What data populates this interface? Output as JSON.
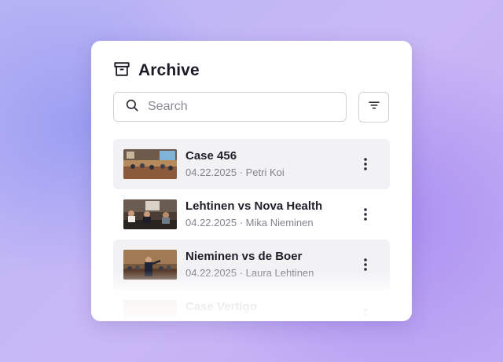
{
  "header": {
    "title": "Archive",
    "icon": "archive-box-icon"
  },
  "search": {
    "placeholder": "Search",
    "value": ""
  },
  "filter": {
    "icon": "filter-icon"
  },
  "items": [
    {
      "title": "Case 456",
      "date": "04.22.2025",
      "separator": " · ",
      "author": "Petri Koi"
    },
    {
      "title": "Lehtinen vs Nova Health",
      "date": "04.22.2025",
      "separator": " · ",
      "author": "Mika Nieminen"
    },
    {
      "title": "Nieminen vs de Boer",
      "date": "04.22.2025",
      "separator": " · ",
      "author": "Laura Lehtinen"
    },
    {
      "title": "Case Vertigo"
    }
  ],
  "colors": {
    "accent_text": "#1f1f2a",
    "muted_text": "#83848c",
    "row_highlight": "#f2f2f5"
  }
}
